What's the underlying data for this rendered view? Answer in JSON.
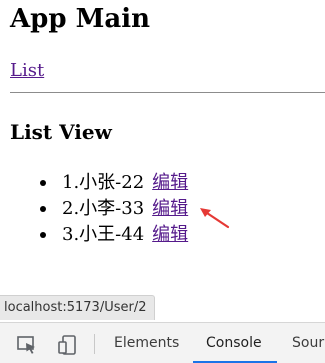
{
  "app": {
    "title": "App Main",
    "nav_link": "List"
  },
  "list_view": {
    "title": "List View",
    "edit_label": "编辑",
    "items": [
      {
        "text": "1.小张-22"
      },
      {
        "text": "2.小李-33"
      },
      {
        "text": "3.小王-44"
      }
    ]
  },
  "status_bar": {
    "url": "localhost:5173/User/2"
  },
  "devtools": {
    "icons": [
      "inspect-element-icon",
      "device-toolbar-icon"
    ],
    "tabs": [
      {
        "label": "Elements",
        "active": false
      },
      {
        "label": "Console",
        "active": true
      },
      {
        "label": "Sour",
        "active": false
      }
    ]
  },
  "colors": {
    "visited_link": "#551a8b",
    "annotation_arrow": "#e53935",
    "devtools_active_tab": "#1a73e8"
  }
}
